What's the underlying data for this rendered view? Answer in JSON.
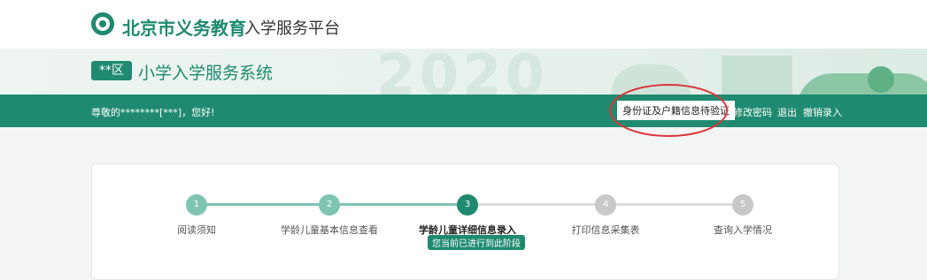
{
  "header": {
    "logo_title": "北京市义务教育",
    "logo_subtitle": "入学服务平台"
  },
  "banner": {
    "district_badge": "**区",
    "system_title": "小学入学服务系统",
    "background_year": "2020"
  },
  "navbar": {
    "greeting": "尊敬的********[***]，您好!",
    "verify_status": "身份证及户籍信息待验证",
    "change_password": "修改密码",
    "logout": "退出",
    "cancel_registration": "撤销录入"
  },
  "steps": [
    {
      "number": "1",
      "label": "阅读须知",
      "state": "done"
    },
    {
      "number": "2",
      "label": "学龄儿童基本信息查看",
      "state": "done"
    },
    {
      "number": "3",
      "label": "学龄儿童详细信息录入",
      "state": "current"
    },
    {
      "number": "4",
      "label": "打印信息采集表",
      "state": "todo"
    },
    {
      "number": "5",
      "label": "查询入学情况",
      "state": "todo"
    }
  ],
  "current_stage_tag": "您当前已进行到此阶段",
  "colors": {
    "brand": "#1f8a6f",
    "step_done": "#7fc4b3",
    "step_todo": "#c8c8c8",
    "annotation": "#d9343a"
  }
}
